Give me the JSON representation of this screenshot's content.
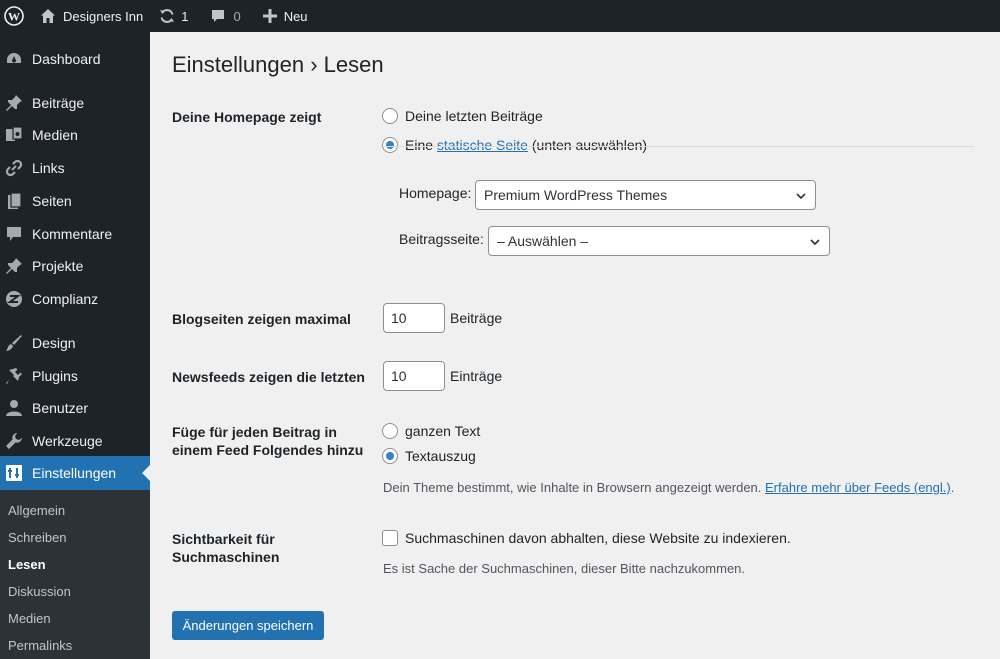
{
  "adminbar": {
    "site_name": "Designers Inn",
    "updates_count": "1",
    "comments_count": "0",
    "new_label": "Neu"
  },
  "sidebar": {
    "items": [
      {
        "label": "Dashboard",
        "icon": "dashboard-icon"
      },
      {
        "label": "Beiträge",
        "icon": "pin-icon"
      },
      {
        "label": "Medien",
        "icon": "media-icon"
      },
      {
        "label": "Links",
        "icon": "link-icon"
      },
      {
        "label": "Seiten",
        "icon": "pages-icon"
      },
      {
        "label": "Kommentare",
        "icon": "comment-icon"
      },
      {
        "label": "Projekte",
        "icon": "pin-icon"
      },
      {
        "label": "Complianz",
        "icon": "complianz-icon"
      },
      {
        "label": "Design",
        "icon": "brush-icon"
      },
      {
        "label": "Plugins",
        "icon": "plugin-icon"
      },
      {
        "label": "Benutzer",
        "icon": "user-icon"
      },
      {
        "label": "Werkzeuge",
        "icon": "wrench-icon"
      },
      {
        "label": "Einstellungen",
        "icon": "settings-icon"
      }
    ],
    "submenu": [
      "Allgemein",
      "Schreiben",
      "Lesen",
      "Diskussion",
      "Medien",
      "Permalinks"
    ],
    "submenu_current": "Lesen"
  },
  "main": {
    "title": "Einstellungen › Lesen",
    "homepage": {
      "label": "Deine Homepage zeigt",
      "option_latest": "Deine letzten Beiträge",
      "option_static_prefix": "Eine",
      "option_static_link": "statische Seite",
      "option_static_suffix": "(unten auswählen)",
      "selected": "static",
      "homepage_label": "Homepage:",
      "homepage_value": "Premium WordPress Themes",
      "postspage_label": "Beitragsseite:",
      "postspage_value": "– Auswählen –"
    },
    "blog_pages": {
      "label": "Blogseiten zeigen maximal",
      "value": "10",
      "suffix": "Beiträge"
    },
    "feeds": {
      "label": "Newsfeeds zeigen die letzten",
      "value": "10",
      "suffix": "Einträge"
    },
    "feed_content": {
      "label_line1": "Füge für jeden Beitrag in",
      "label_line2": "einem Feed Folgendes hinzu",
      "option_full": "ganzen Text",
      "option_excerpt": "Textauszug",
      "selected": "excerpt",
      "description": "Dein Theme bestimmt, wie Inhalte in Browsern angezeigt werden.",
      "description_link": "Erfahre mehr über Feeds (engl.)",
      "description_end": "."
    },
    "visibility": {
      "label_line1": "Sichtbarkeit für",
      "label_line2": "Suchmaschinen",
      "checkbox_label": "Suchmaschinen davon abhalten, diese Website zu indexieren.",
      "checked": false,
      "description": "Es ist Sache der Suchmaschinen, dieser Bitte nachzukommen."
    },
    "save_button": "Änderungen speichern"
  },
  "colors": {
    "accent": "#2271b1",
    "sidebar_bg": "#1d2327",
    "submenu_bg": "#2c3338",
    "content_bg": "#f0f0f1"
  }
}
